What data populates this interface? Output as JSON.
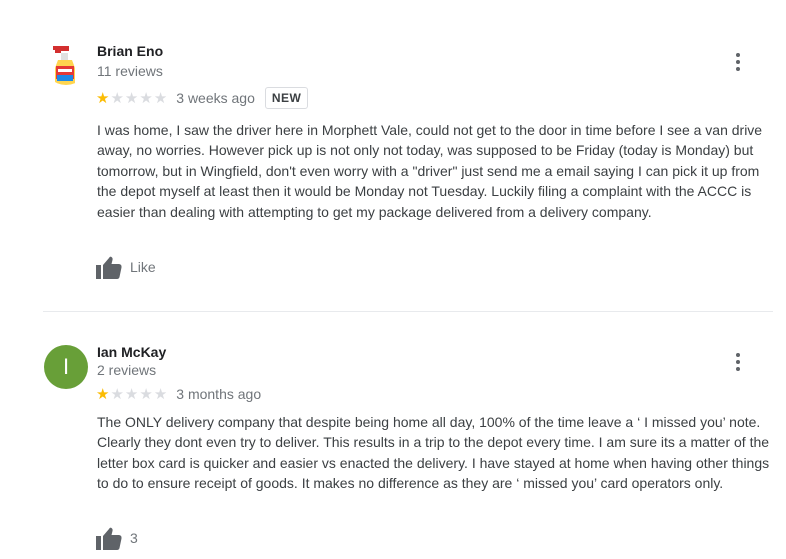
{
  "reviews": [
    {
      "author": "Brian Eno",
      "review_count": "11 reviews",
      "rating": 1,
      "max_rating": 5,
      "time": "3 weeks ago",
      "badge": "NEW",
      "text": "I was home, I saw the driver here in Morphett Vale, could not get to the door in time before I see a van drive away, no worries. However pick up is not only not today, was supposed to be Friday (today is Monday) but tomorrow, but in Wingfield, don't even worry with a \"driver\" just send me a email saying I can pick it up from the depot myself at least then it would be Monday not Tuesday. Luckily filing a complaint with the ACCC is easier than dealing with attempting to get my package delivered from a delivery company.",
      "like_label": "Like",
      "avatar_icon": "spray-bottle-avatar"
    },
    {
      "author": "Ian McKay",
      "review_count": "2 reviews",
      "rating": 1,
      "max_rating": 5,
      "time": "3 months ago",
      "avatar_initial": "I",
      "avatar_color": "#689f38",
      "text": "The ONLY delivery company that despite being home all day, 100% of the time leave a  ‘ I missed you’ note. Clearly they dont even try to deliver. This results in a trip to the depot every time. I am sure its a matter of the letter box card is quicker and easier vs enacted the delivery. I have stayed at home when having other things to do to ensure receipt of goods. It makes no difference as they are ‘ missed you’ card operators only.",
      "like_label": "3"
    }
  ],
  "colors": {
    "star_filled": "#fbbc04",
    "star_empty": "#dadce0",
    "secondary_text": "#70757a"
  },
  "icons": {
    "more": "more-vert-icon",
    "like": "thumbs-up-icon",
    "star": "star-icon"
  }
}
